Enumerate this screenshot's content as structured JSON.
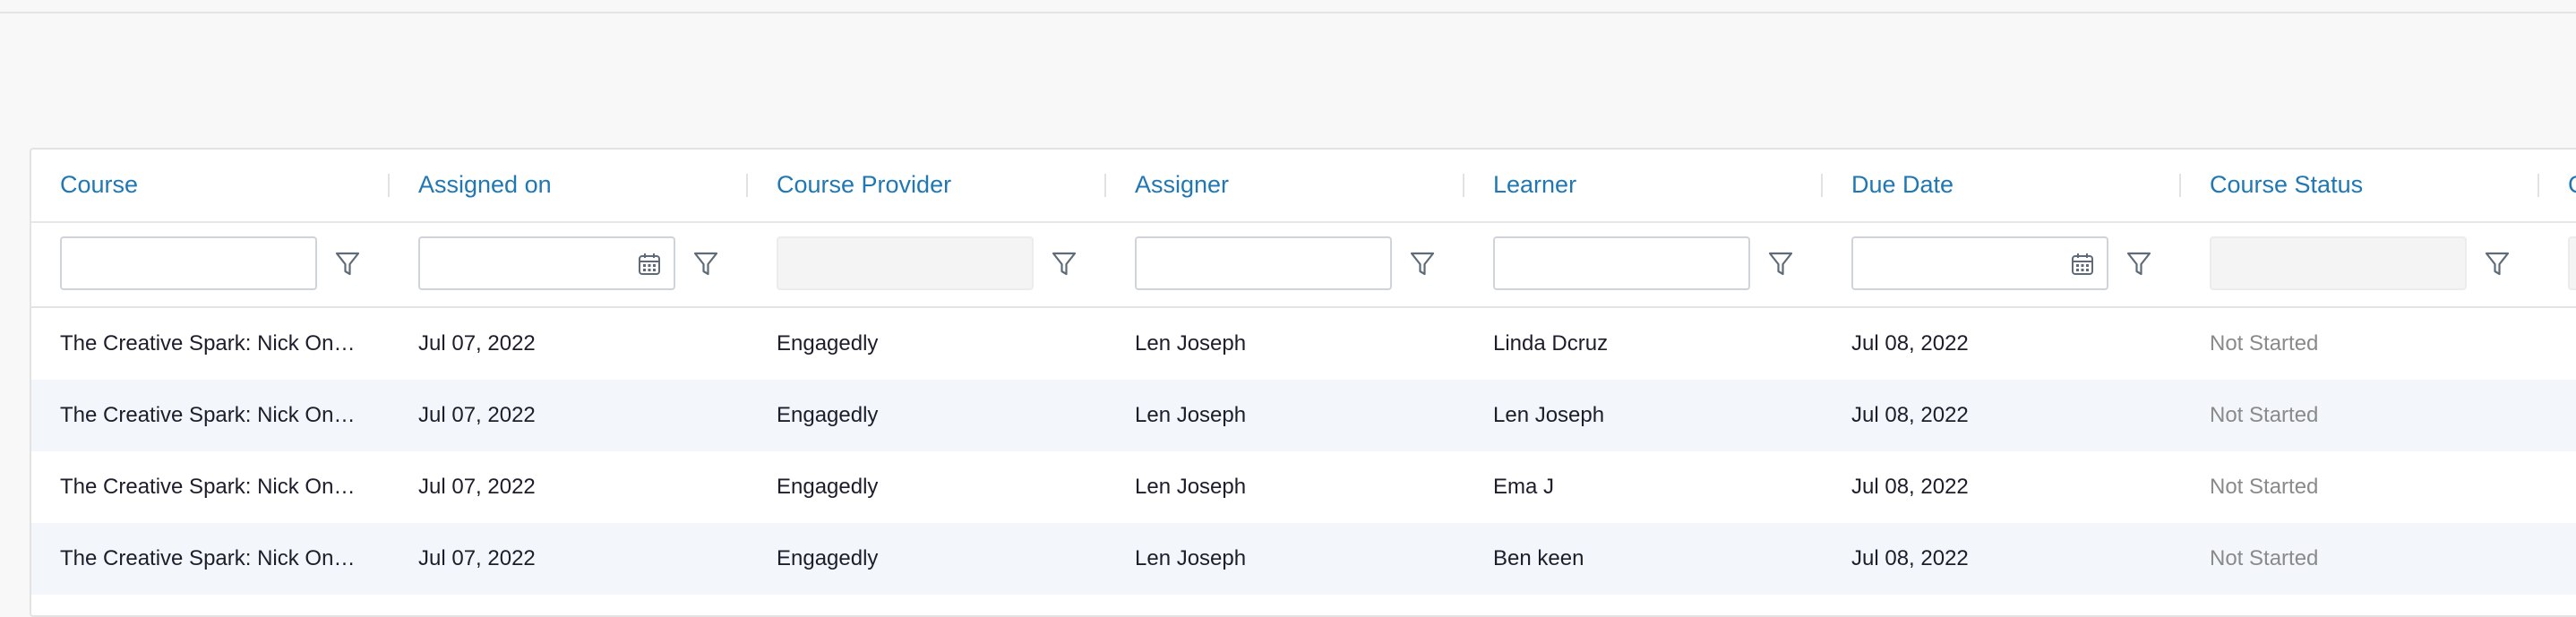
{
  "grid": {
    "columns": [
      {
        "key": "course",
        "label": "Course",
        "filter": "text"
      },
      {
        "key": "assigned_on",
        "label": "Assigned on",
        "filter": "date"
      },
      {
        "key": "provider",
        "label": "Course Provider",
        "filter": "disabled"
      },
      {
        "key": "assigner",
        "label": "Assigner",
        "filter": "text"
      },
      {
        "key": "learner",
        "label": "Learner",
        "filter": "text"
      },
      {
        "key": "due_date",
        "label": "Due Date",
        "filter": "date"
      },
      {
        "key": "status",
        "label": "Course Status",
        "filter": "disabled"
      },
      {
        "key": "extra",
        "label": "C",
        "filter": "disabled"
      }
    ],
    "rows": [
      {
        "course": "The Creative Spark: Nick Onk…",
        "assigned_on": "Jul 07, 2022",
        "provider": "Engagedly",
        "assigner": "Len Joseph",
        "learner": "Linda Dcruz",
        "due_date": "Jul 08, 2022",
        "status": "Not Started"
      },
      {
        "course": "The Creative Spark: Nick Onk…",
        "assigned_on": "Jul 07, 2022",
        "provider": "Engagedly",
        "assigner": "Len Joseph",
        "learner": "Len Joseph",
        "due_date": "Jul 08, 2022",
        "status": "Not Started"
      },
      {
        "course": "The Creative Spark: Nick Onk…",
        "assigned_on": "Jul 07, 2022",
        "provider": "Engagedly",
        "assigner": "Len Joseph",
        "learner": "Ema J",
        "due_date": "Jul 08, 2022",
        "status": "Not Started"
      },
      {
        "course": "The Creative Spark: Nick Onk…",
        "assigned_on": "Jul 07, 2022",
        "provider": "Engagedly",
        "assigner": "Len Joseph",
        "learner": "Ben keen",
        "due_date": "Jul 08, 2022",
        "status": "Not Started"
      }
    ]
  },
  "colors": {
    "header_text": "#1f77b4",
    "row_alt": "#f3f7fb",
    "muted_text": "#8a8a8a"
  },
  "icons": {
    "filter": "funnel-icon",
    "date": "calendar-icon"
  }
}
